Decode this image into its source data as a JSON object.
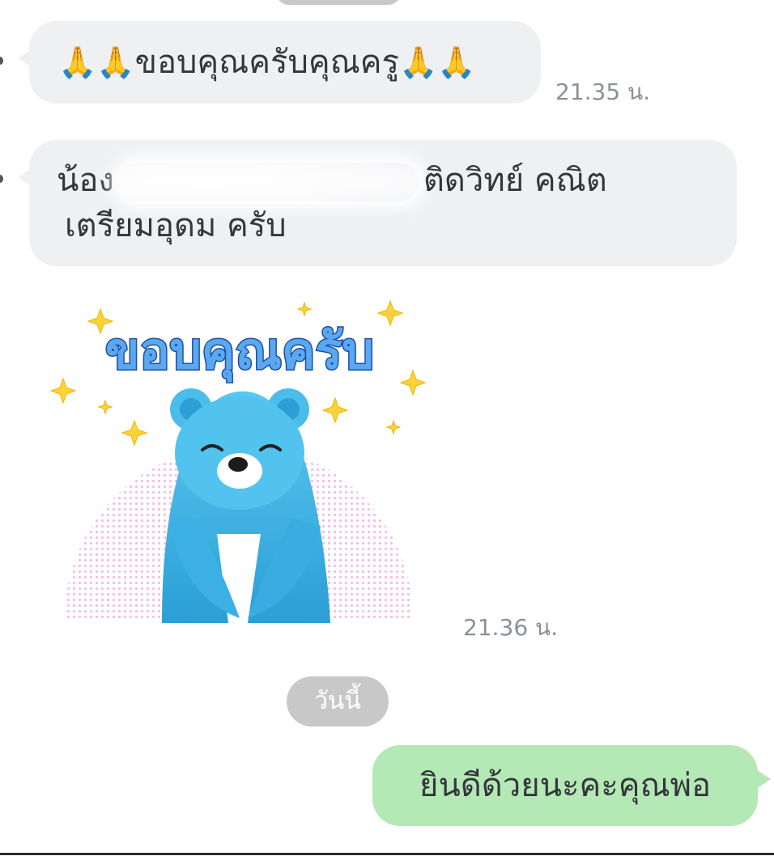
{
  "messages": [
    {
      "emoji_left": "🙏🙏",
      "text": "ขอบคุณครับคุณครู",
      "emoji_right": "🙏🙏",
      "time": "21.35 น."
    },
    {
      "prefix": "น้อง",
      "suffix": "ติดวิทย์ คณิต",
      "line2": "เตรียมอุดม ครับ"
    },
    {
      "sticker_text": "ขอบคุณครับ",
      "time": "21.36 น."
    }
  ],
  "day_separator": "วันนี้",
  "outgoing": {
    "text": "ยินดีด้วยนะคะคุณพ่อ"
  },
  "colors": {
    "incoming_bubble": "#eef0f2",
    "outgoing_bubble": "#b4e8b4",
    "bear_blue": "#3fb4e6",
    "pill_gray": "#c8c8c8"
  }
}
